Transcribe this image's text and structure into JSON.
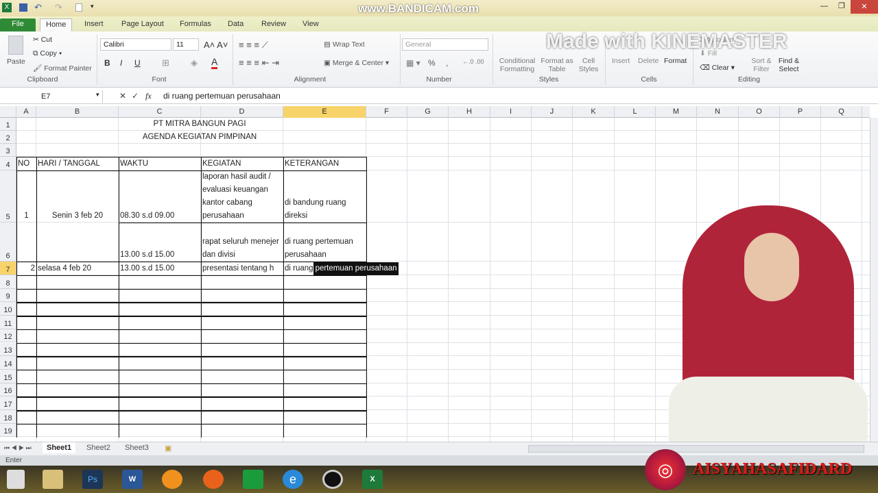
{
  "quick_access": {
    "icons": [
      "excel-icon",
      "save-icon",
      "undo-icon",
      "redo-icon",
      "new-icon",
      "customize-icon"
    ]
  },
  "watermarks": {
    "bandicam": "www.BANDICAM.com",
    "kinemaster": "Made with KINEMASTER",
    "instagram": "AISYAHASAFIDARD"
  },
  "tabs": [
    "File",
    "Home",
    "Insert",
    "Page Layout",
    "Formulas",
    "Data",
    "Review",
    "View"
  ],
  "ribbon": {
    "clipboard": {
      "paste": "Paste",
      "cut": "Cut",
      "copy": "Copy",
      "format_painter": "Format Painter",
      "label": "Clipboard"
    },
    "font": {
      "name": "Calibri",
      "size": "11",
      "bold": "B",
      "italic": "I",
      "underline": "U",
      "label": "Font"
    },
    "alignment": {
      "wrap": "Wrap Text",
      "merge": "Merge & Center",
      "label": "Alignment"
    },
    "number": {
      "format": "General",
      "percent": "%",
      "comma": ",",
      "label": "Number"
    },
    "styles": {
      "conditional": "Conditional Formatting",
      "format_table": "Format as Table",
      "cell_styles": "Cell Styles",
      "label": "Styles"
    },
    "cells": {
      "insert": "Insert",
      "delete": "Delete",
      "format": "Format",
      "label": "Cells"
    },
    "editing": {
      "autosum": "AutoSum",
      "fill": "Fill",
      "clear": "Clear",
      "sort": "Sort & Filter",
      "find": "Find & Select",
      "label": "Editing"
    }
  },
  "formula_bar": {
    "name_box": "E7",
    "fx": "fx",
    "value": "di ruang pertemuan perusahaan"
  },
  "columns": [
    "A",
    "B",
    "C",
    "D",
    "E",
    "F",
    "G",
    "H",
    "I",
    "J",
    "K",
    "L",
    "M",
    "N",
    "O",
    "P",
    "Q"
  ],
  "selected_column": "E",
  "selected_row": 7,
  "sheet": {
    "title1": "PT  MITRA BANGUN PAGI",
    "title2": "AGENDA KEGIATAN PIMPINAN",
    "headers": [
      "NO",
      "HARI / TANGGAL",
      "WAKTU",
      "KEGIATAN",
      "KETERANGAN"
    ],
    "rows": [
      {
        "no": "1",
        "day": "Senin 3 feb 20",
        "time": "08.30 s.d 09.00",
        "activity": "laporan hasil audit / evaluasi keuangan kantor cabang perusahaan",
        "note": "di bandung ruang direksi"
      },
      {
        "no": "",
        "day": "",
        "time": "13.00 s.d 15.00",
        "activity": "rapat seluruh menejer dan divisi",
        "note": "di ruang pertemuan perusahaan"
      },
      {
        "no": "2",
        "day": "selasa 4 feb 20",
        "time": "13.00 s.d 15.00",
        "activity": "presentasi tentang h",
        "note": "di ruang ",
        "note_editing": "pertemuan perusahaan"
      }
    ]
  },
  "sheet_tabs": [
    "Sheet1",
    "Sheet2",
    "Sheet3"
  ],
  "status": "Enter",
  "taskbar": [
    "windows-start",
    "file-explorer",
    "photoshop",
    "word",
    "app",
    "firefox",
    "store",
    "internet-explorer",
    "bandicam",
    "excel"
  ]
}
